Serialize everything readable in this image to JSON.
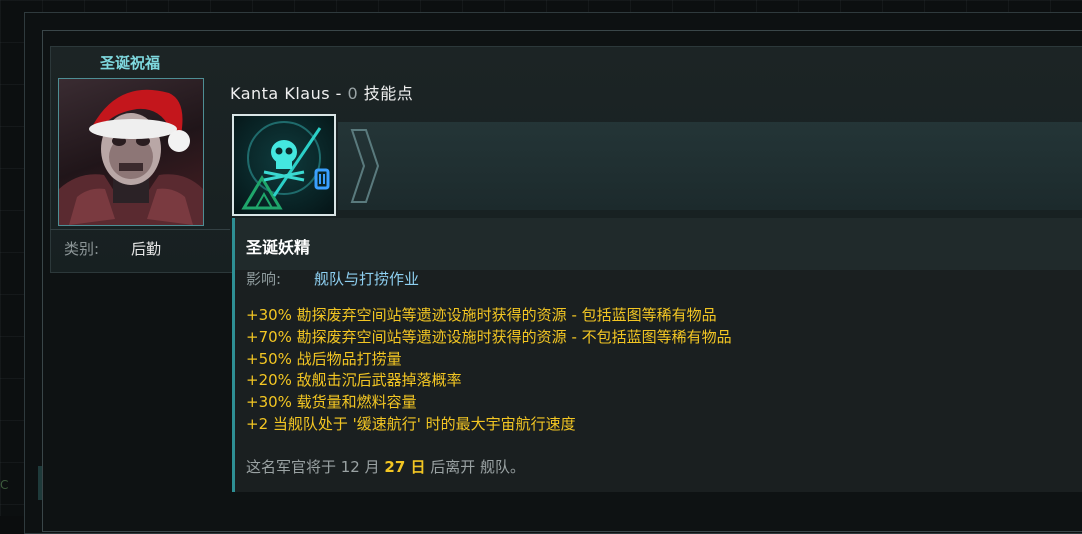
{
  "officer": {
    "portrait_title": "圣诞祝福",
    "name": "Kanta Klaus",
    "separator": " - ",
    "skill_points_value": "0",
    "skill_points_label": "技能点",
    "category_label": "类别:",
    "category_value": "后勤"
  },
  "skill": {
    "icon": "skull-anchor-icon",
    "title": "圣诞妖精",
    "effect_label": "影响:",
    "effect_value": "舰队与打捞作业",
    "bonuses": [
      "+30% 勘探废弃空间站等遗迹设施时获得的资源 - 包括蓝图等稀有物品",
      "+70% 勘探废弃空间站等遗迹设施时获得的资源 - 不包括蓝图等稀有物品",
      "+50% 战后物品打捞量",
      "+20% 敌舰击沉后武器掉落概率",
      "+30% 载货量和燃料容量",
      "+2 当舰队处于 '缓速航行' 时的最大宇宙航行速度"
    ],
    "leave_note_prefix": "这名军官将于 12 月 ",
    "leave_note_day": "27 日",
    "leave_note_suffix": " 后离开 舰队。"
  },
  "colors": {
    "title_cyan": "#7fd9df",
    "bonus_yellow": "#f3c623",
    "effect_blue": "#8ecff0",
    "accent_teal": "#2e8f94"
  },
  "side": {
    "mark": "C"
  }
}
